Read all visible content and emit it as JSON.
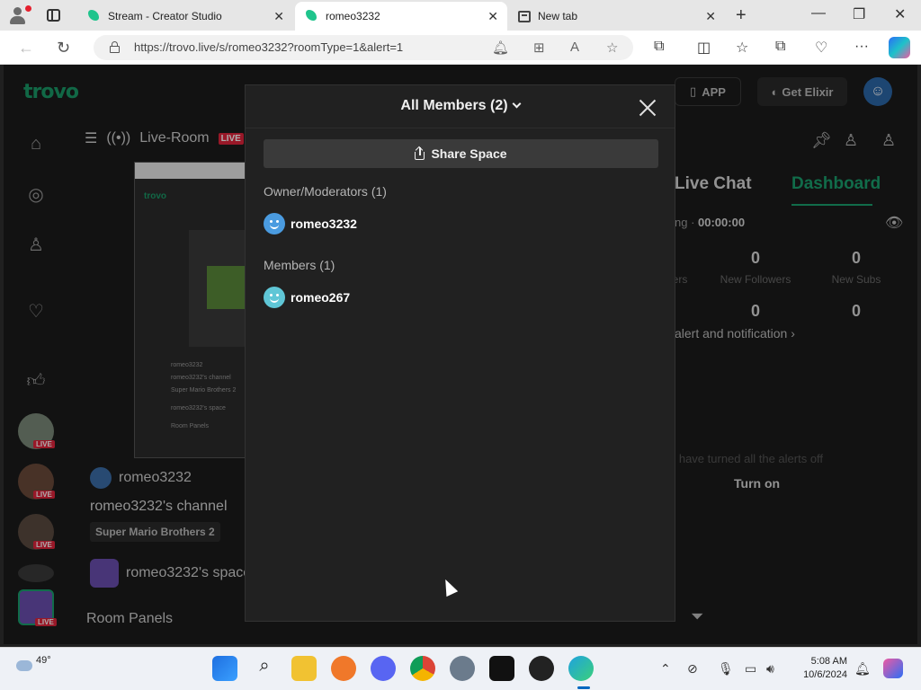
{
  "browser": {
    "tabs": [
      {
        "title": "Stream - Creator Studio",
        "active": false
      },
      {
        "title": "romeo3232",
        "active": true
      },
      {
        "title": "New tab",
        "active": false
      }
    ],
    "url": "https://trovo.live/s/romeo3232?roomType=1&alert=1"
  },
  "site": {
    "logo": "trovo",
    "app_button": "APP",
    "elixir_button": "Get Elixir"
  },
  "subheader": {
    "label": "Live-Room",
    "live_badge": "LIVE"
  },
  "nav_live_badge": "LIVE",
  "channel_info": {
    "streamer": "romeo3232",
    "channel_title": "romeo3232's channel",
    "game": "Super Mario Brothers 2",
    "space": "romeo3232's space",
    "room_panels": "Room Panels"
  },
  "right_panel": {
    "tabs": [
      "Live Chat",
      "Dashboard"
    ],
    "active_tab": "Dashboard",
    "timer_prefix": "ng · ",
    "timer": "00:00:00",
    "stats": [
      {
        "value": "0",
        "label": "New Followers"
      },
      {
        "value": "0",
        "label": "New Subs"
      },
      {
        "value": "0",
        "label": ""
      },
      {
        "value": "0",
        "label": ""
      }
    ],
    "stats_cut_label": "ers",
    "alert_link": "alert and notification",
    "alerts_off": "u have turned all the alerts off",
    "turn_on": "Turn on"
  },
  "modal": {
    "title": "All Members (2)",
    "share_button": "Share Space",
    "owner_section": "Owner/Moderators (1)",
    "owners": [
      {
        "name": "romeo3232",
        "avatar_color": "#4a9be0"
      }
    ],
    "members_section": "Members (1)",
    "members": [
      {
        "name": "romeo267",
        "avatar_color": "#5fc6d6"
      }
    ]
  },
  "preview": {
    "lines": [
      "romeo3232",
      "romeo3232's channel",
      "Super Mario Brothers 2",
      "romeo3232's space",
      "Room Panels"
    ]
  },
  "taskbar": {
    "weather_temp": "49°",
    "time": "5:08 AM",
    "date": "10/6/2024"
  },
  "colors": {
    "trovo_green": "#1aa06d",
    "modal_bg": "#212121",
    "page_bg": "#1b1b1b",
    "live_red": "#e0243c"
  }
}
